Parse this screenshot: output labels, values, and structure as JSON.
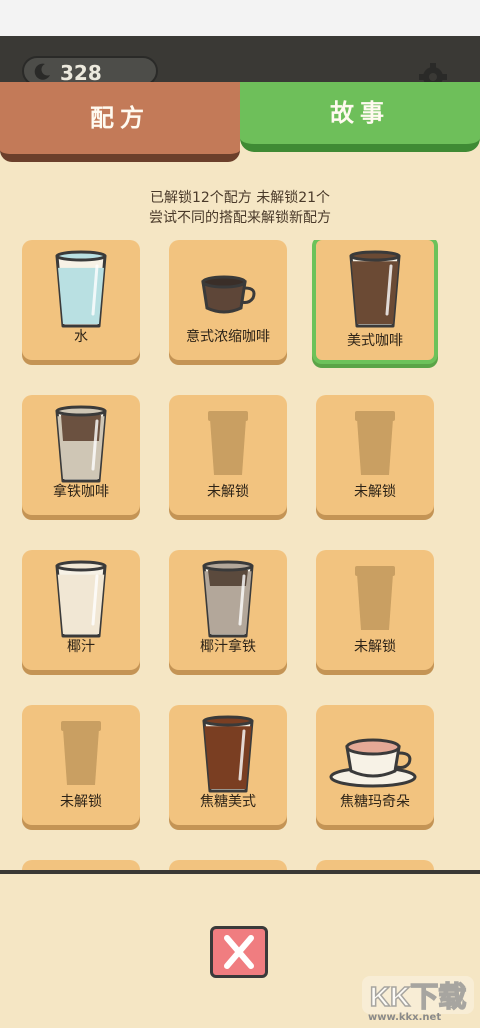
{
  "header": {
    "score": "328"
  },
  "tabs": [
    {
      "label": "配方",
      "active": true
    },
    {
      "label": "故事",
      "active": false
    }
  ],
  "info": {
    "line1": "已解锁12个配方 未解锁21个",
    "line2": "尝试不同的搭配来解锁新配方"
  },
  "recipes": [
    {
      "label": "水",
      "icon": "water-glass-icon"
    },
    {
      "label": "意式浓缩咖啡",
      "icon": "espresso-cup-icon"
    },
    {
      "label": "美式咖啡",
      "icon": "americano-glass-icon",
      "selected": true
    },
    {
      "label": "拿铁咖啡",
      "icon": "latte-glass-icon"
    },
    {
      "label": "未解锁",
      "icon": "locked-cup-icon"
    },
    {
      "label": "未解锁",
      "icon": "locked-cup-icon"
    },
    {
      "label": "椰汁",
      "icon": "coconut-milk-glass-icon"
    },
    {
      "label": "椰汁拿铁",
      "icon": "coconut-latte-glass-icon"
    },
    {
      "label": "未解锁",
      "icon": "locked-cup-icon"
    },
    {
      "label": "未解锁",
      "icon": "locked-cup-icon"
    },
    {
      "label": "焦糖美式",
      "icon": "caramel-americano-glass-icon"
    },
    {
      "label": "焦糖玛奇朵",
      "icon": "caramel-macchiato-cup-icon"
    }
  ],
  "watermark": {
    "text": "www.kkx.net",
    "brand": "KK下载"
  },
  "colors": {
    "recipe_tab": "#c37a58",
    "story_tab": "#6ebf5a",
    "card": "#f2c37f",
    "selected_border": "#6cc25a",
    "close": "#f07d80"
  }
}
